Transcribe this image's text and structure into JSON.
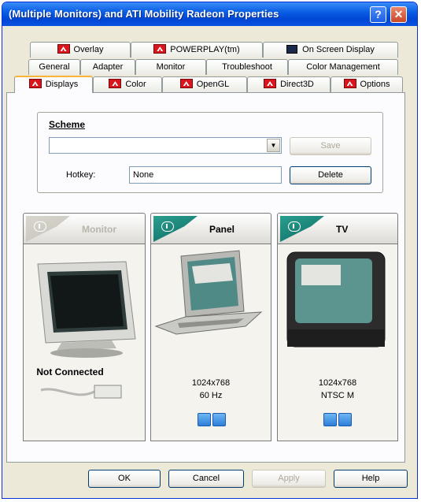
{
  "window": {
    "title": "(Multiple Monitors) and ATI Mobility Radeon Properties",
    "help_glyph": "?",
    "close_glyph": "✕"
  },
  "tabs": {
    "row1": [
      "Overlay",
      "POWERPLAY(tm)",
      "On Screen Display"
    ],
    "row2": [
      "General",
      "Adapter",
      "Monitor",
      "Troubleshoot",
      "Color Management"
    ],
    "row3": [
      "Displays",
      "Color",
      "OpenGL",
      "Direct3D",
      "Options"
    ],
    "active": "Displays"
  },
  "scheme": {
    "label": "Scheme",
    "value": "",
    "save_label": "Save",
    "hotkey_label": "Hotkey:",
    "hotkey_value": "None",
    "delete_label": "Delete"
  },
  "displays": [
    {
      "name": "Monitor",
      "enabled": false,
      "status": "Not Connected",
      "info1": "",
      "info2": ""
    },
    {
      "name": "Panel",
      "enabled": true,
      "status": "",
      "info1": "1024x768",
      "info2": "60 Hz"
    },
    {
      "name": "TV",
      "enabled": true,
      "status": "",
      "info1": "1024x768",
      "info2": "NTSC M"
    }
  ],
  "buttons": {
    "ok": "OK",
    "cancel": "Cancel",
    "apply": "Apply",
    "help": "Help"
  }
}
